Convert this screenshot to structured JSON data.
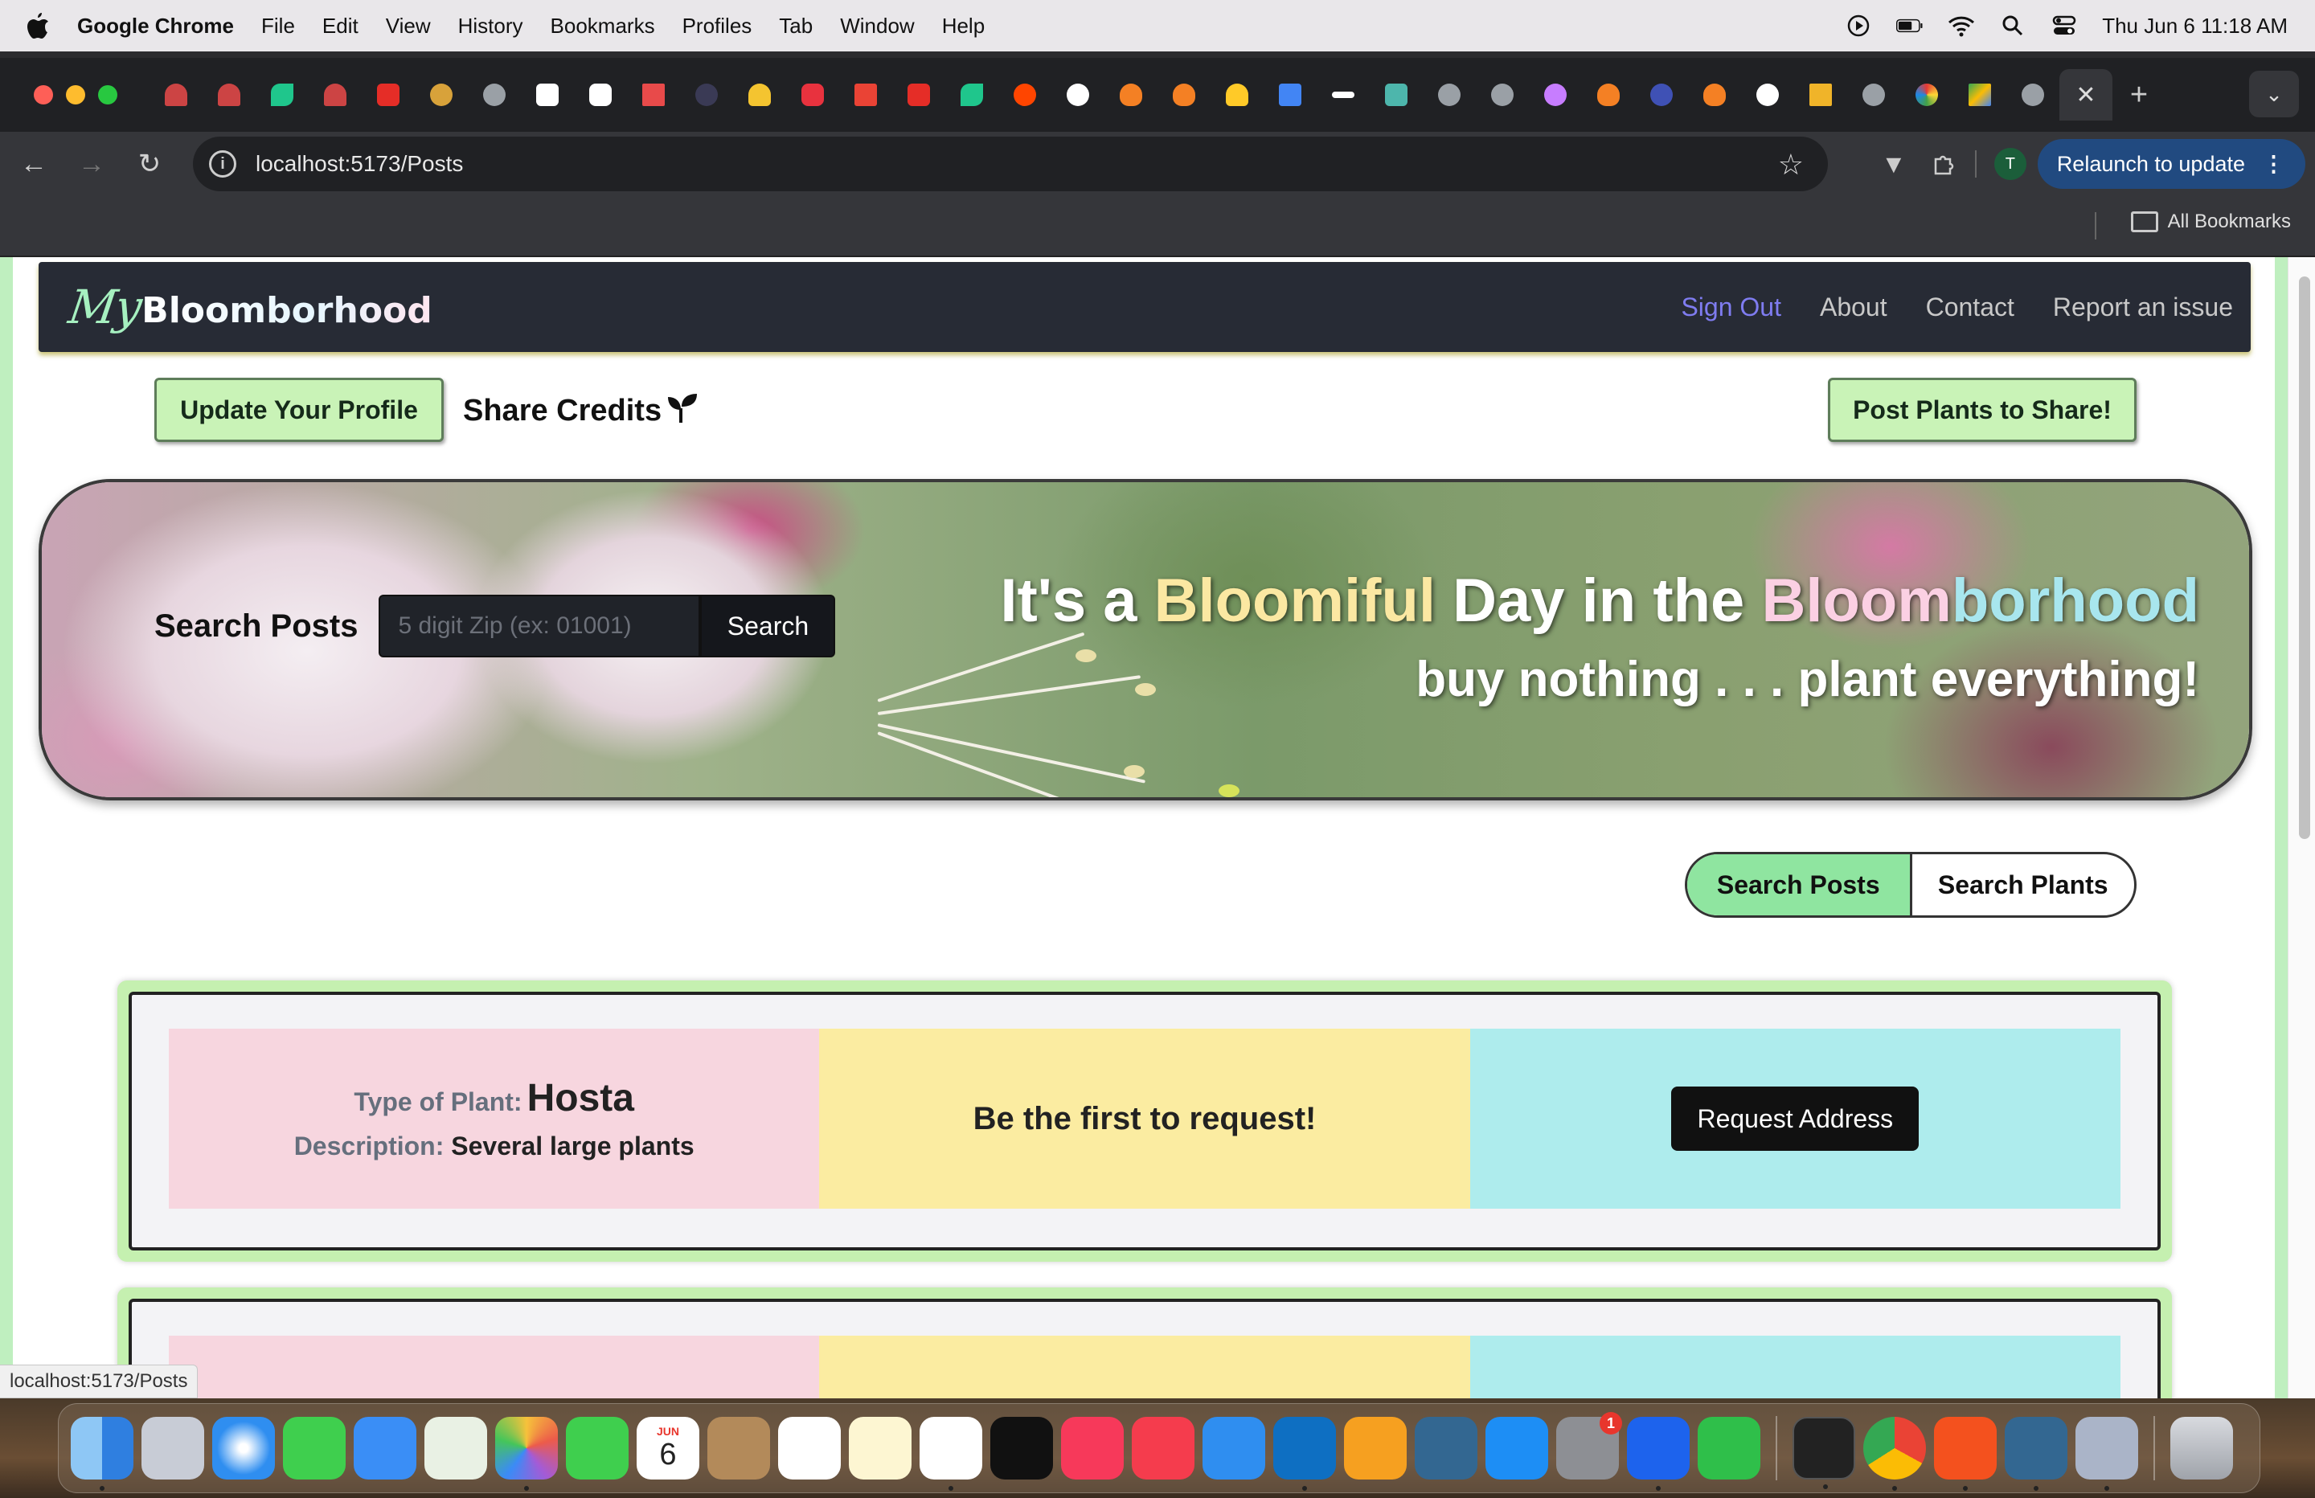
{
  "menubar": {
    "app": "Google Chrome",
    "items": [
      "File",
      "Edit",
      "View",
      "History",
      "Bookmarks",
      "Profiles",
      "Tab",
      "Window",
      "Help"
    ],
    "datetime": "Thu Jun 6  11:18 AM"
  },
  "browser": {
    "url": "localhost:5173/Posts",
    "relaunch_label": "Relaunch to update",
    "profile_initial": "T",
    "all_bookmarks": "All Bookmarks",
    "status_url": "localhost:5173/Posts"
  },
  "site": {
    "logo_my": "My",
    "logo_name": "Bloomborhood",
    "nav": {
      "sign_out": "Sign Out",
      "about": "About",
      "contact": "Contact",
      "report": "Report an issue"
    },
    "update_profile": "Update Your Profile",
    "share_credits": "Share Credits",
    "post_plants": "Post Plants to Share!",
    "hero": {
      "w1": "It's a ",
      "w2": "Bloomiful",
      "w3": " Day in the ",
      "w4": "Bloom",
      "w5": "borhood",
      "tagline": "buy nothing . . . plant everything!"
    },
    "search": {
      "label": "Search Posts",
      "placeholder": "5 digit Zip (ex: 01001)",
      "button": "Search",
      "toggle_posts": "Search Posts",
      "toggle_plants": "Search Plants"
    },
    "posts": [
      {
        "type_label": "Type of Plant:",
        "type_value": "Hosta",
        "desc_label": "Description:",
        "desc_value": "Several large plants",
        "message": "Be the first to request!",
        "action": "Request Address"
      }
    ]
  },
  "dock": {
    "calendar_month": "JUN",
    "calendar_day": "6",
    "settings_badge": "1"
  },
  "colors": {
    "nav_bg": "#272b35",
    "accent_green": "#c9f3b7",
    "toggle_active": "#8fe5a0",
    "cell_pink": "#f7d6df",
    "cell_yellow": "#fbeca1",
    "cell_cyan": "#aeeced"
  }
}
